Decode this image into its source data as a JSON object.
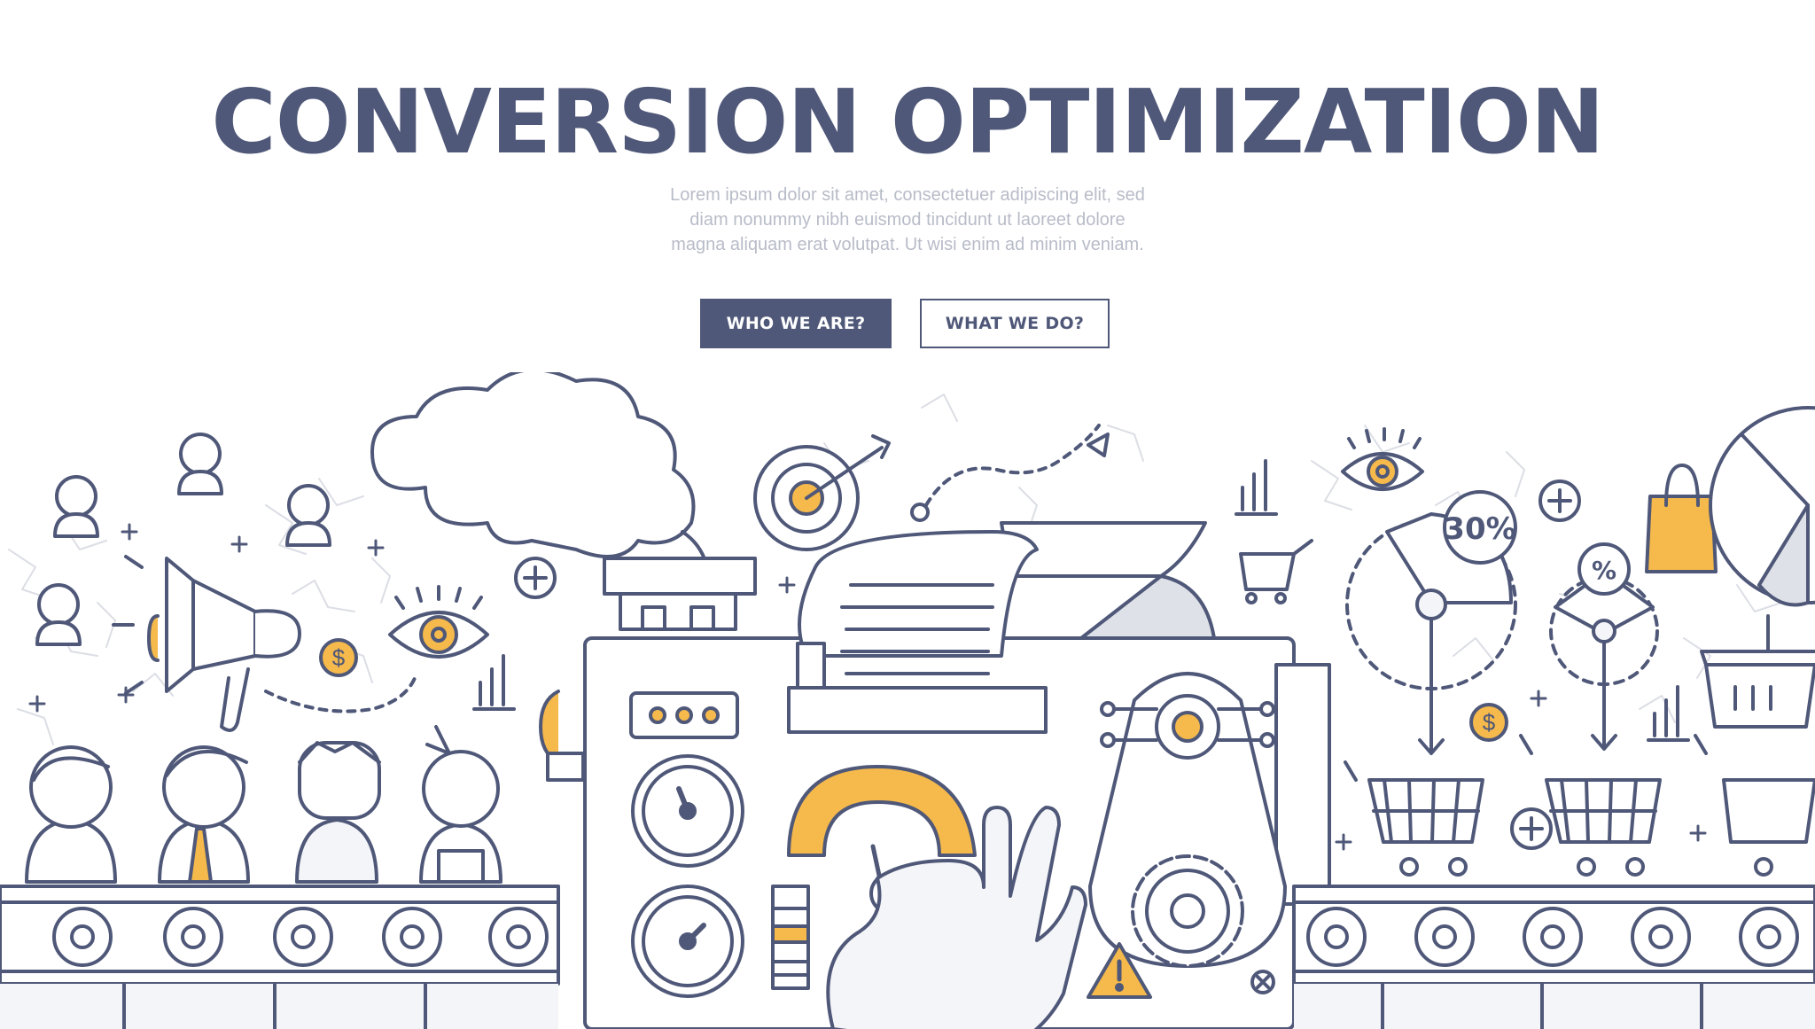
{
  "hero": {
    "title": "CONVERSION OPTIMIZATION",
    "subtitle_lines": [
      "Lorem ipsum dolor sit amet, consectetuer adipiscing elit, sed",
      "diam nonummy nibh euismod tincidunt ut laoreet dolore",
      "magna aliquam erat volutpat. Ut wisi enim ad minim veniam."
    ]
  },
  "buttons": {
    "primary_label": "WHO WE ARE?",
    "secondary_label": "WHAT WE DO?"
  },
  "illustration": {
    "percent_label": "30%",
    "percent_symbol": "%",
    "dollar_symbol": "$",
    "colors": {
      "outline": "#4f5878",
      "accent": "#f5b94c",
      "fill_light": "#f4f5f8",
      "shadow": "#dfe1e8",
      "background": "#ffffff"
    }
  }
}
